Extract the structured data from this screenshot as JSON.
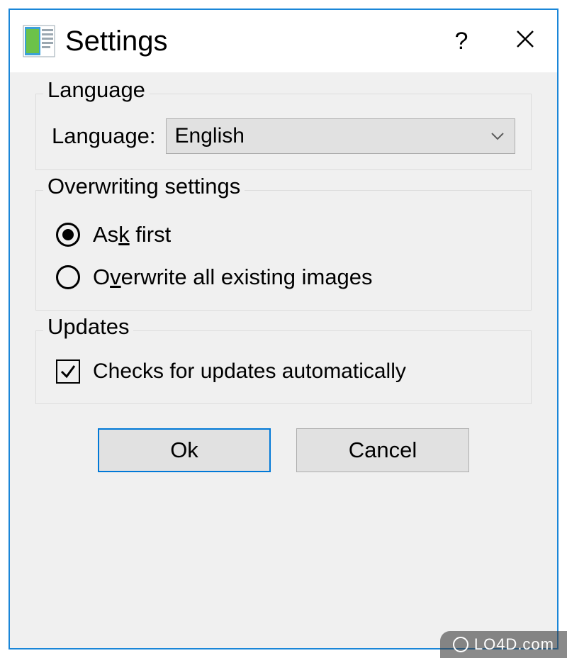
{
  "window": {
    "title": "Settings"
  },
  "groups": {
    "language": {
      "legend": "Language",
      "label": "Language:",
      "selected": "English"
    },
    "overwriting": {
      "legend": "Overwriting settings",
      "options": {
        "ask_first_pre": "As",
        "ask_first_mn": "k",
        "ask_first_post": " first",
        "overwrite_pre": "O",
        "overwrite_mn": "v",
        "overwrite_post": "erwrite all existing images"
      },
      "selected": "ask_first"
    },
    "updates": {
      "legend": "Updates",
      "check_label": "Checks for updates automatically",
      "checked": true
    }
  },
  "buttons": {
    "ok": "Ok",
    "cancel": "Cancel"
  },
  "titlebar": {
    "help": "?"
  },
  "watermark": "LO4D.com"
}
